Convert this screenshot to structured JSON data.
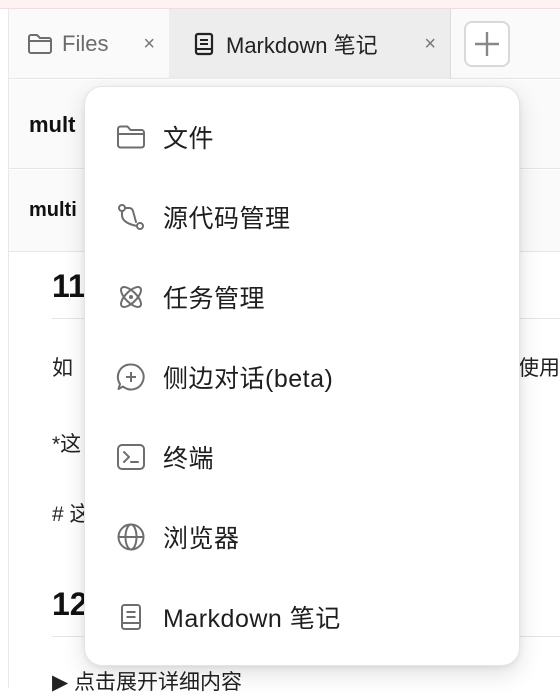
{
  "tabs": [
    {
      "label": "Files",
      "close": "×",
      "icon": "folder-icon"
    },
    {
      "label": "Markdown 笔记",
      "close": "×",
      "icon": "notebook-icon"
    }
  ],
  "add_tab": {
    "label": "+",
    "icon": "plus-icon"
  },
  "rows": [
    {
      "title": "mult"
    },
    {
      "title": "multi"
    }
  ],
  "document": {
    "heading_11": "11",
    "para_1_left": "如",
    "para_1_right": "以使用",
    "para_2": "*这",
    "para_3": "# 这",
    "heading_12": "12",
    "details": "▶ 点击展开详细内容"
  },
  "menu": {
    "items": [
      {
        "label": "文件",
        "icon": "folder-icon"
      },
      {
        "label": "源代码管理",
        "icon": "git-branch-icon"
      },
      {
        "label": "任务管理",
        "icon": "atom-icon"
      },
      {
        "label": "侧边对话(beta)",
        "icon": "chat-plus-icon"
      },
      {
        "label": "终端",
        "icon": "terminal-icon"
      },
      {
        "label": "浏览器",
        "icon": "globe-icon"
      },
      {
        "label": "Markdown 笔记",
        "icon": "notebook-icon"
      }
    ]
  },
  "colors": {
    "icon": "#6e6e6e",
    "menu_bg": "#ffffff",
    "tab_active_bg": "#ededed"
  }
}
